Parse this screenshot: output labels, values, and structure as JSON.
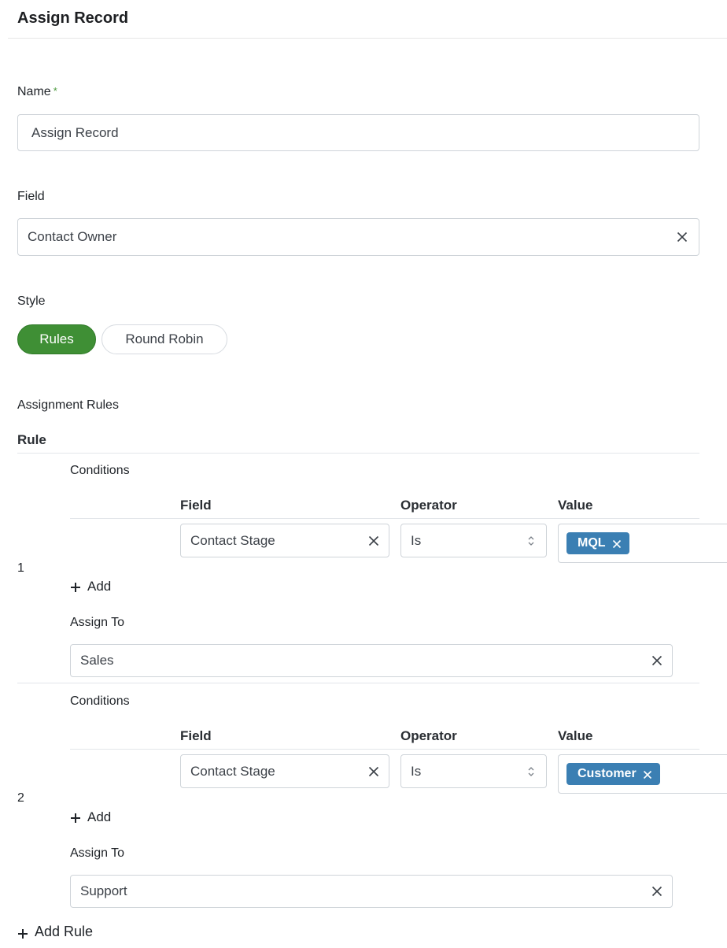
{
  "header": {
    "title": "Assign Record"
  },
  "name_field": {
    "label": "Name",
    "required_mark": "*",
    "value": "Assign Record"
  },
  "field_field": {
    "label": "Field",
    "value": "Contact Owner"
  },
  "style": {
    "label": "Style",
    "options": [
      {
        "label": "Rules",
        "selected": true
      },
      {
        "label": "Round Robin",
        "selected": false
      }
    ]
  },
  "assignment_rules": {
    "label": "Assignment Rules",
    "rule_header": "Rule",
    "columns": {
      "field": "Field",
      "operator": "Operator",
      "value": "Value"
    },
    "conditions_label": "Conditions",
    "add_label": "Add",
    "assign_to_label": "Assign To",
    "rules": [
      {
        "number": "1",
        "condition": {
          "field": "Contact Stage",
          "operator": "Is",
          "value_tag": "MQL"
        },
        "assign_to": "Sales"
      },
      {
        "number": "2",
        "condition": {
          "field": "Contact Stage",
          "operator": "Is",
          "value_tag": "Customer"
        },
        "assign_to": "Support"
      }
    ],
    "add_rule_label": "Add Rule"
  },
  "colors": {
    "accent_green": "#3f8f35",
    "tag_blue": "#3b7fb3",
    "required_green": "#4b9a3d",
    "border": "#cfd4d9"
  },
  "icons": {
    "clear": "close-icon",
    "select": "chevron-up-down-icon",
    "add": "plus-icon"
  }
}
